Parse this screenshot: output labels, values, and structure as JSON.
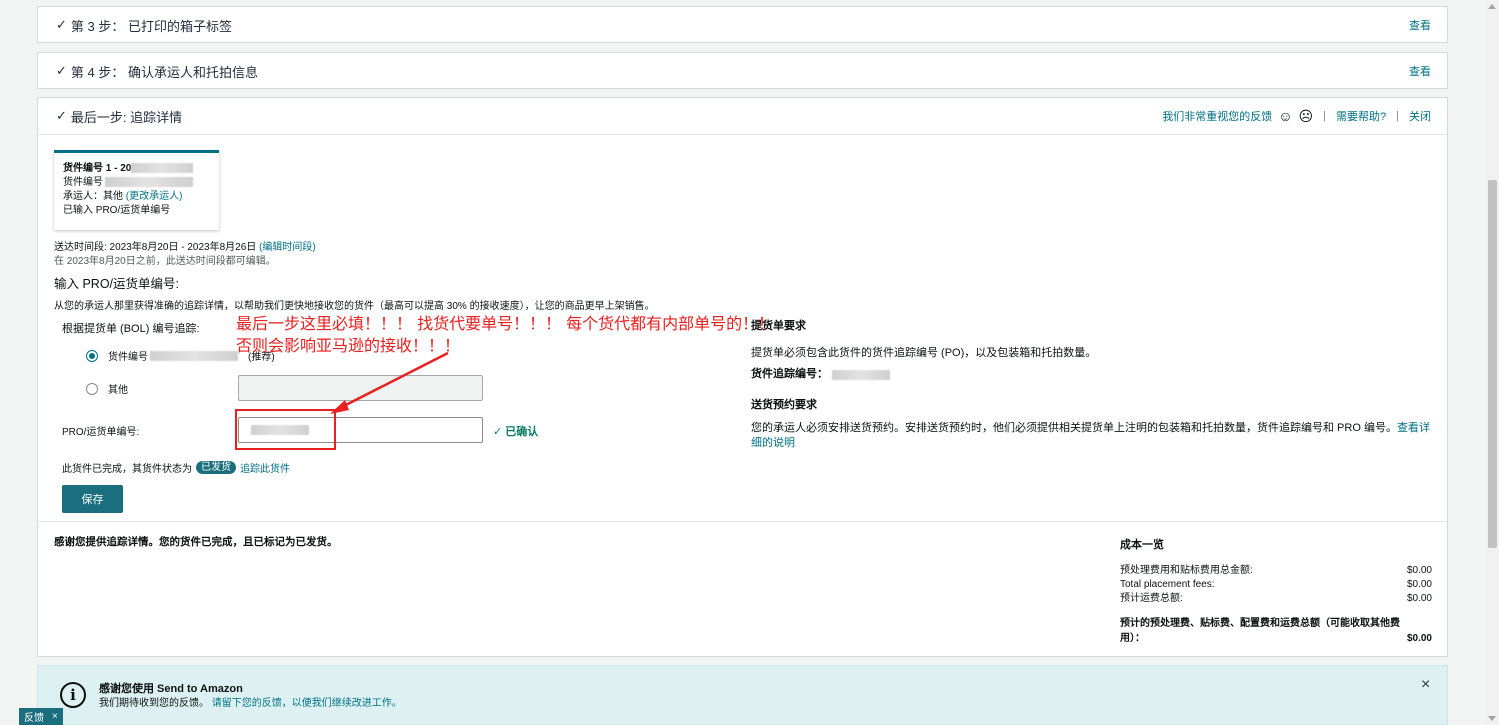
{
  "step3": {
    "title": "第 3 步： 已打印的箱子标签",
    "link": "查看"
  },
  "step4": {
    "title": "第 4 步： 确认承运人和托拍信息",
    "link": "查看"
  },
  "final": {
    "title": "最后一步: 追踪详情",
    "feedback_text": "我们非常重视您的反馈",
    "help_link": "需要帮助?",
    "close_link": "关闭",
    "card": {
      "shipment_line": "货件编号 1 - 20",
      "id_label": "货件编号",
      "carrier_label": "承运人：其他",
      "carrier_link": "(更改承运人)",
      "pro_status": "已输入 PRO/运货单编号"
    },
    "delivery_window": "送达时间段: 2023年8月20日 - 2023年8月26日",
    "edit_window_link": "(编辑时间段)",
    "editable_note": "在 2023年8月20日之前，此送达时间段都可编辑。",
    "pro_heading": "输入 PRO/运货单编号:",
    "pro_desc": "从您的承运人那里获得准确的追踪详情，以帮助我们更快地接收您的货件（最高可以提高 30% 的接收速度），让您的商品更早上架销售。",
    "bol_label": "根据提货单 (BOL) 编号追踪:",
    "option1_label": "货件编号",
    "option1_suffix": "(推荐)",
    "option2_label": "其他",
    "pro_field_label": "PRO/运货单编号:",
    "confirmed": "已确认",
    "status_text": "此货件已完成，其货件状态为",
    "status_badge": "已发货",
    "track_link": "追踪此货件",
    "save_label": "保存",
    "annotation_line1": "最后一步这里必填！！！ 找货代要单号！！！ 每个货代都有内部单号的！！",
    "annotation_line2": "否则会影响亚马逊的接收！！！",
    "bol_req_title": "提货单要求",
    "bol_req_text": "提货单必须包含此货件的货件追踪编号 (PO)，以及包装箱和托拍数量。",
    "tracking_id_label": "货件追踪编号：",
    "appt_title": "送货预约要求",
    "appt_text": "您的承运人必须安排送货预约。安排送货预约时，他们必须提供相关提货单上注明的包装箱和托拍数量，货件追踪编号和 PRO 编号。",
    "appt_link": "查看详细的说明",
    "thanks": "感谢您提供追踪详情。您的货件已完成，且已标记为已发货。",
    "costs": {
      "title": "成本一览",
      "rows": [
        {
          "label": "预处理费用和贴标费用总金额:",
          "value": "$0.00"
        },
        {
          "label": "Total placement fees:",
          "value": "$0.00"
        },
        {
          "label": "预计运费总额:",
          "value": "$0.00"
        }
      ],
      "total_label": "预计的预处理费、贴标费、配置费和运费总额（可能收取其他费用）：",
      "total_value": "$0.00"
    }
  },
  "footer": {
    "title": "感谢您使用 Send to Amazon",
    "text": "我们期待收到您的反馈。",
    "link": "请留下您的反馈，以便我们继续改进工作。",
    "close": "×"
  },
  "feedback_tab": {
    "label": "反馈",
    "close": "×"
  },
  "colors": {
    "accent": "#007185",
    "button": "#1b6e7e",
    "annotation": "#e8201f"
  }
}
